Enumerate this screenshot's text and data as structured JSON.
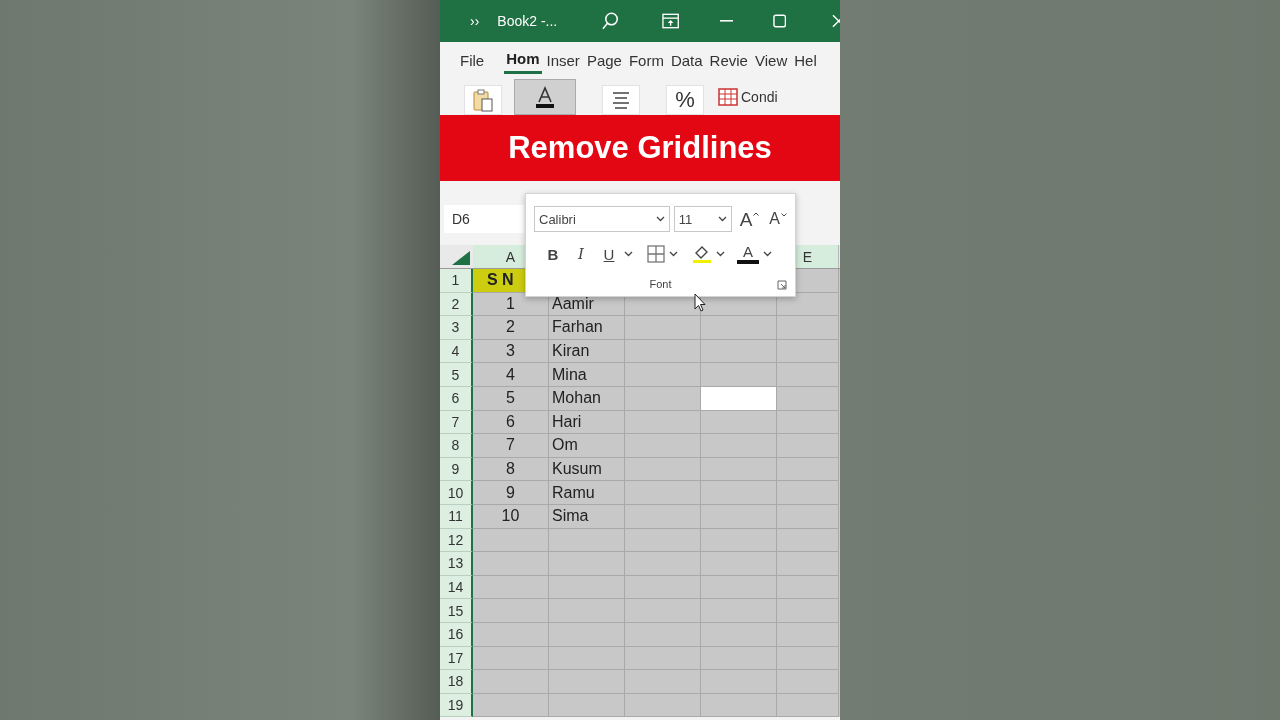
{
  "title_bar": {
    "overflow": "››",
    "title": "Book2 -..."
  },
  "tabs": [
    {
      "label": "File",
      "selected": false
    },
    {
      "label": "Hom",
      "selected": true
    },
    {
      "label": "Inser",
      "selected": false
    },
    {
      "label": "Page",
      "selected": false
    },
    {
      "label": "Form",
      "selected": false
    },
    {
      "label": "Data",
      "selected": false
    },
    {
      "label": "Revie",
      "selected": false
    },
    {
      "label": "View",
      "selected": false
    },
    {
      "label": "Hel",
      "selected": false
    }
  ],
  "ribbon": [
    {
      "kind": "clipboard",
      "selected": false
    },
    {
      "kind": "font",
      "selected": true
    },
    {
      "kind": "align",
      "selected": false
    },
    {
      "kind": "percent",
      "label": "%",
      "selected": false
    },
    {
      "kind": "conditional",
      "label": "Condi",
      "selected": false
    }
  ],
  "banner": "Remove Gridlines",
  "name_box": "D6",
  "font_popup": {
    "font_name": "Calibri",
    "font_size": "11",
    "grow_label": "A",
    "shrink_label": "A",
    "buttons": [
      {
        "kind": "bold",
        "label": "B"
      },
      {
        "kind": "italic",
        "label": "I"
      },
      {
        "kind": "underline",
        "label": "U"
      },
      {
        "kind": "borders"
      },
      {
        "kind": "fill"
      },
      {
        "kind": "color",
        "label": "A"
      }
    ],
    "group_label": "Font"
  },
  "column_headers": {
    "first": "A",
    "last": "E"
  },
  "rows": [
    {
      "number": "1",
      "a": "S N",
      "heading": true
    },
    {
      "number": "2",
      "a": "1",
      "b": "Aamir",
      "heading": false,
      "d_selected": false
    },
    {
      "number": "3",
      "a": "2",
      "b": "Farhan",
      "heading": false,
      "d_selected": false
    },
    {
      "number": "4",
      "a": "3",
      "b": "Kiran",
      "heading": false,
      "d_selected": false
    },
    {
      "number": "5",
      "a": "4",
      "b": "Mina",
      "heading": false,
      "d_selected": false
    },
    {
      "number": "6",
      "a": "5",
      "b": "Mohan",
      "heading": false,
      "d_selected": true
    },
    {
      "number": "7",
      "a": "6",
      "b": "Hari",
      "heading": false,
      "d_selected": false
    },
    {
      "number": "8",
      "a": "7",
      "b": "Om",
      "heading": false,
      "d_selected": false
    },
    {
      "number": "9",
      "a": "8",
      "b": "Kusum",
      "heading": false,
      "d_selected": false
    },
    {
      "number": "10",
      "a": "9",
      "b": "Ramu",
      "heading": false,
      "d_selected": false
    },
    {
      "number": "11",
      "a": "10",
      "b": "Sima",
      "heading": false,
      "d_selected": false
    },
    {
      "number": "12",
      "heading": false,
      "d_selected": false
    },
    {
      "number": "13",
      "heading": false,
      "d_selected": false
    },
    {
      "number": "14",
      "heading": false,
      "d_selected": false
    },
    {
      "number": "15",
      "heading": false,
      "d_selected": false
    },
    {
      "number": "16",
      "heading": false,
      "d_selected": false
    },
    {
      "number": "17",
      "heading": false,
      "d_selected": false
    },
    {
      "number": "18",
      "heading": false,
      "d_selected": false
    },
    {
      "number": "19",
      "heading": false,
      "d_selected": false
    }
  ]
}
